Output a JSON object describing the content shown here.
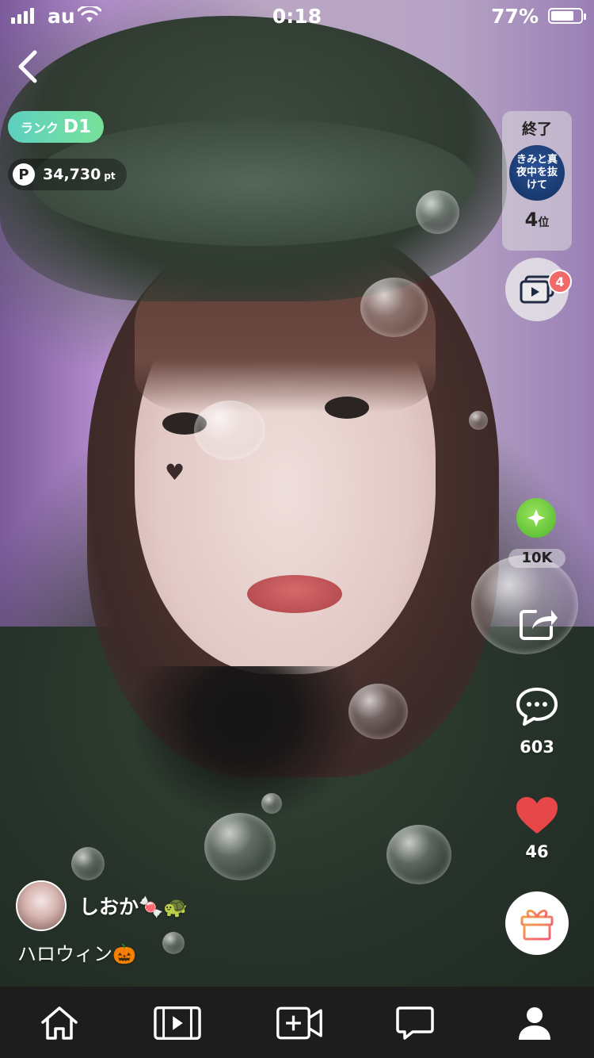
{
  "status_bar": {
    "carrier": "au",
    "time": "0:18",
    "battery_percent": "77%",
    "battery_level": 0.77
  },
  "rank": {
    "label": "ランク",
    "value": "D1"
  },
  "points": {
    "icon_letter": "P",
    "value": "34,730",
    "unit": "pt"
  },
  "event": {
    "status": "終了",
    "badge_text": "きみと真夜中を抜けて",
    "position_number": "4",
    "position_suffix": "位"
  },
  "videos": {
    "badge_count": "4"
  },
  "gems": {
    "count": "10K"
  },
  "comments": {
    "count": "603"
  },
  "likes": {
    "count": "46"
  },
  "user": {
    "name": "しおか🍬🐢"
  },
  "caption": "ハロウィン🎃",
  "colors": {
    "rank_gradient_start": "#5dd0c0",
    "rank_gradient_end": "#78e29a",
    "like_red": "#e8474a",
    "gem_green": "#4bb52b",
    "tabbar_bg": "#1d1d1d"
  },
  "icons": {
    "back": "chevron-left-icon",
    "video": "video-stack-icon",
    "gem": "gem-icon",
    "share": "share-icon",
    "comment": "comment-bubble-icon",
    "like": "heart-icon",
    "gift": "gift-icon",
    "tabs": [
      "home-icon",
      "film-icon",
      "add-video-icon",
      "chat-icon",
      "profile-icon"
    ]
  }
}
